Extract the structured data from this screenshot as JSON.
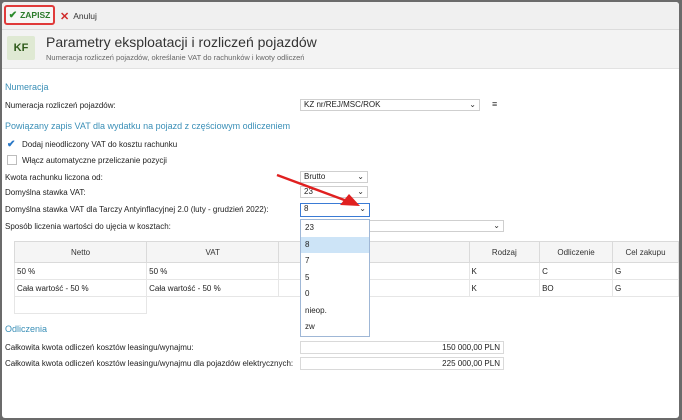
{
  "toolbar": {
    "save_label": "ZAPISZ",
    "cancel_label": "Anuluj"
  },
  "header": {
    "icon_text": "KF",
    "title": "Parametry eksploatacji i rozliczeń pojazdów",
    "subtitle": "Numeracja rozliczeń pojazdów, określanie VAT do rachunków i kwoty odliczeń"
  },
  "numeracja": {
    "section": "Numeracja",
    "label": "Numeracja rozliczeń pojazdów:",
    "value": "KZ nr/REJ/MSC/ROK"
  },
  "vat": {
    "section": "Powiązany zapis VAT dla wydatku na pojazd z częściowym odliczeniem",
    "check1_label": "Dodaj nieodliczony VAT do kosztu rachunku",
    "check1_checked": true,
    "check2_label": "Włącz automatyczne przeliczanie pozycji",
    "check2_checked": false,
    "kwota_label": "Kwota rachunku liczona od:",
    "kwota_value": "Brutto",
    "stawka_label": "Domyślna stawka VAT:",
    "stawka_value": "23",
    "tarcza_label": "Domyślna stawka VAT dla Tarczy Antyinflacyjnej 2.0 (luty - grudzień 2022):",
    "tarcza_value": "8",
    "sposob_label": "Sposób liczenia wartości do ujęcia w kosztach:",
    "sposob_value_visible": "zycji"
  },
  "dropdown_options": [
    "23",
    "8",
    "7",
    "5",
    "0",
    "nieop.",
    "zw"
  ],
  "dropdown_selected": "8",
  "table": {
    "headers": [
      "Netto",
      "VAT",
      "V",
      "Rodzaj",
      "Odliczenie",
      "Cel zakupu"
    ],
    "rows": [
      [
        "50 %",
        "50 %",
        "",
        "K",
        "C",
        "G"
      ],
      [
        "Cała wartość - 50 %",
        "Cała wartość - 50 %",
        "",
        "K",
        "BO",
        "G"
      ]
    ]
  },
  "odliczenia": {
    "section": "Odliczenia",
    "row1_label": "Całkowita kwota odliczeń kosztów leasingu/wynajmu:",
    "row1_value": "150 000,00 PLN",
    "row2_label": "Całkowita kwota odliczeń kosztów leasingu/wynajmu dla pojazdów elektrycznych:",
    "row2_value": "225 000,00 PLN"
  },
  "colors": {
    "accent": "#3a8fb7",
    "save_border": "#e03a3a",
    "annotation_arrow": "#e02020",
    "selected_option": "#cde4f7"
  }
}
